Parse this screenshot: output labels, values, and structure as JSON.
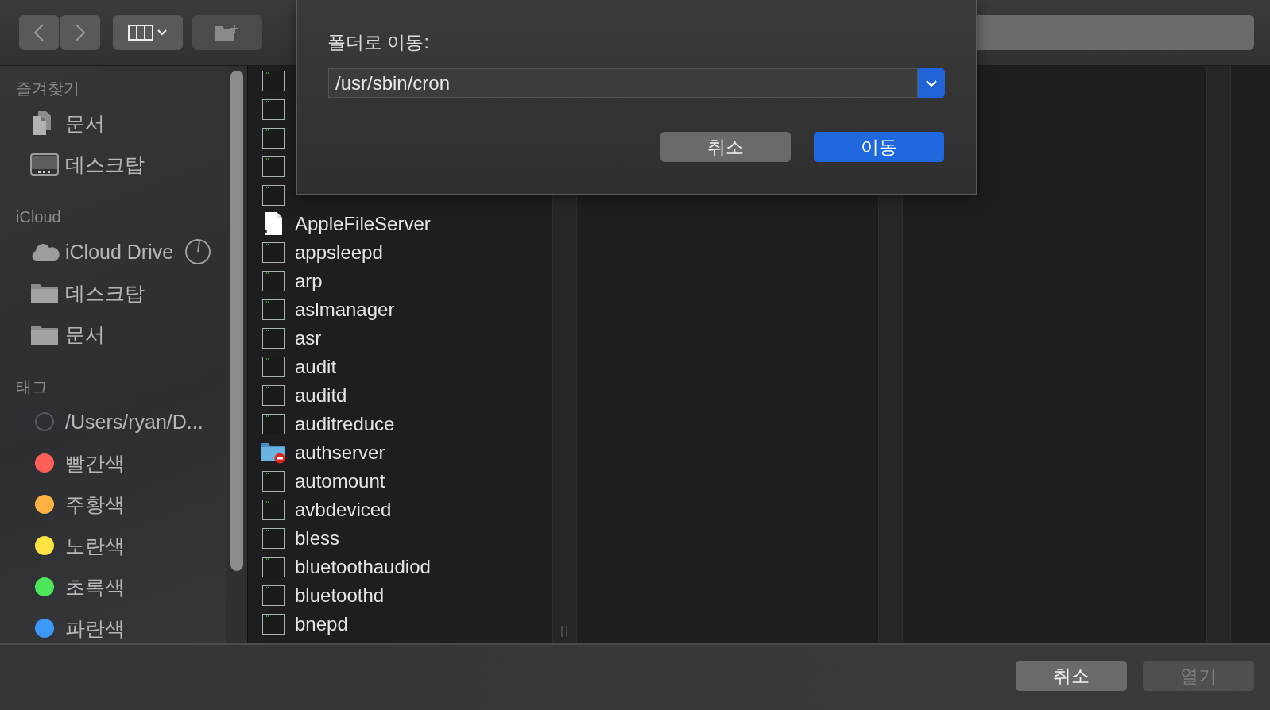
{
  "toolbar": {
    "back_disabled": false,
    "forward_disabled": false,
    "new_folder_disabled": true
  },
  "sidebar": {
    "sections": [
      {
        "heading": "즐겨찾기",
        "items": [
          {
            "label": "문서",
            "kind": "documents"
          },
          {
            "label": "데스크탑",
            "kind": "desktop"
          }
        ]
      },
      {
        "heading": "iCloud",
        "items": [
          {
            "label": "iCloud Drive",
            "kind": "cloud",
            "syncing": true
          },
          {
            "label": "데스크탑",
            "kind": "folder"
          },
          {
            "label": "문서",
            "kind": "folder"
          }
        ]
      },
      {
        "heading": "태그",
        "tags": [
          {
            "label": "/Users/ryan/D...",
            "kind": "ring"
          },
          {
            "label": "빨간색",
            "kind": "dot",
            "color": "#fe5f57"
          },
          {
            "label": "주황색",
            "kind": "dot",
            "color": "#fdb043"
          },
          {
            "label": "노란색",
            "kind": "dot",
            "color": "#fee342"
          },
          {
            "label": "초록색",
            "kind": "dot",
            "color": "#4fe55b"
          },
          {
            "label": "파란색",
            "kind": "dot",
            "color": "#3d98f9"
          }
        ]
      }
    ]
  },
  "files": [
    {
      "kind": "exec"
    },
    {
      "kind": "exec"
    },
    {
      "kind": "exec"
    },
    {
      "kind": "exec"
    },
    {
      "kind": "exec"
    },
    {
      "name": "AppleFileServer",
      "kind": "alias"
    },
    {
      "name": "appsleepd",
      "kind": "exec"
    },
    {
      "name": "arp",
      "kind": "exec"
    },
    {
      "name": "aslmanager",
      "kind": "exec"
    },
    {
      "name": "asr",
      "kind": "exec"
    },
    {
      "name": "audit",
      "kind": "exec"
    },
    {
      "name": "auditd",
      "kind": "exec"
    },
    {
      "name": "auditreduce",
      "kind": "exec"
    },
    {
      "name": "authserver",
      "kind": "restricted-folder"
    },
    {
      "name": "automount",
      "kind": "exec"
    },
    {
      "name": "avbdeviced",
      "kind": "exec"
    },
    {
      "name": "bless",
      "kind": "exec"
    },
    {
      "name": "bluetoothaudiod",
      "kind": "exec"
    },
    {
      "name": "bluetoothd",
      "kind": "exec"
    },
    {
      "name": "bnepd",
      "kind": "exec"
    }
  ],
  "dialog": {
    "title": "폴더로 이동:",
    "path": "/usr/sbin/cron",
    "buttons": [
      {
        "label": "취소",
        "default": false
      },
      {
        "label": "이동",
        "default": true
      }
    ]
  },
  "footer": {
    "buttons": [
      {
        "label": "취소",
        "disabled": false
      },
      {
        "label": "열기",
        "disabled": true
      }
    ]
  }
}
